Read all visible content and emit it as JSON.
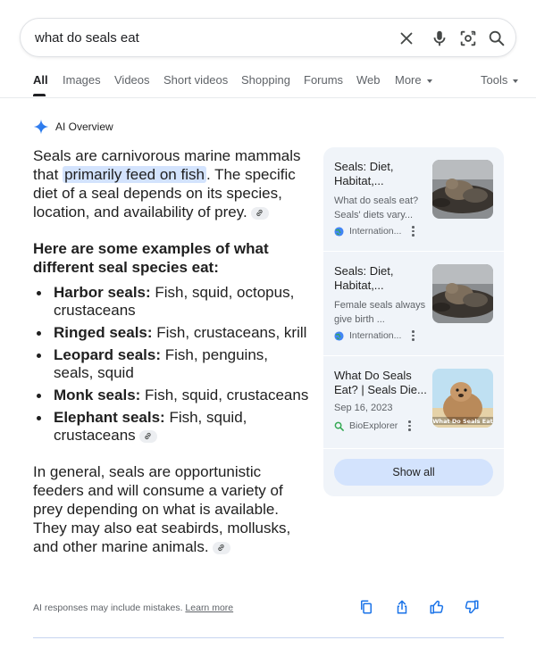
{
  "search": {
    "query": "what do seals eat"
  },
  "tabs": [
    {
      "label": "All",
      "active": true
    },
    {
      "label": "Images"
    },
    {
      "label": "Videos"
    },
    {
      "label": "Short videos"
    },
    {
      "label": "Shopping"
    },
    {
      "label": "Forums"
    },
    {
      "label": "Web"
    },
    {
      "label": "More"
    }
  ],
  "tools_label": "Tools",
  "ai_overview": {
    "header": "AI Overview",
    "intro_before": "Seals are carnivorous marine mammals that ",
    "intro_highlight": "primarily feed on fish",
    "intro_after": ". The specific diet of a seal depends on its species, location, and availability of prey.",
    "subheading": "Here are some examples of what different seal species eat:",
    "bullets": [
      {
        "term": "Harbor seals:",
        "text": " Fish, squid, octopus, crustaceans"
      },
      {
        "term": "Ringed seals:",
        "text": " Fish, crustaceans, krill"
      },
      {
        "term": "Leopard seals:",
        "text": " Fish, penguins, seals, squid"
      },
      {
        "term": "Monk seals:",
        "text": " Fish, squid, crustaceans"
      },
      {
        "term": "Elephant seals:",
        "text": " Fish, squid, crustaceans"
      }
    ],
    "closing": "In general, seals are opportunistic feeders and will consume a variety of prey depending on what is available. They may also eat seabirds, mollusks, and other marine animals.",
    "disclaimer": "AI responses may include mistakes.",
    "learn_more": "Learn more"
  },
  "sources": [
    {
      "title": "Seals: Diet, Habitat,...",
      "snippet": "What do seals eat? Seals' diets vary...",
      "site": "Internation...",
      "icon": "globe-icon"
    },
    {
      "title": "Seals: Diet, Habitat,...",
      "snippet": "Female seals always give birth ...",
      "site": "Internation...",
      "icon": "globe-icon"
    },
    {
      "title": "What Do Seals Eat? | Seals Die...",
      "snippet": "Sep 16, 2023",
      "site": "BioExplorer",
      "icon": "search-icon",
      "thumb_caption": "What Do Seals Eat"
    }
  ],
  "show_all_label": "Show all",
  "colors": {
    "accent": "#1a73e8",
    "highlight": "#d3e3fd",
    "panel_bg": "#f0f4f9"
  }
}
